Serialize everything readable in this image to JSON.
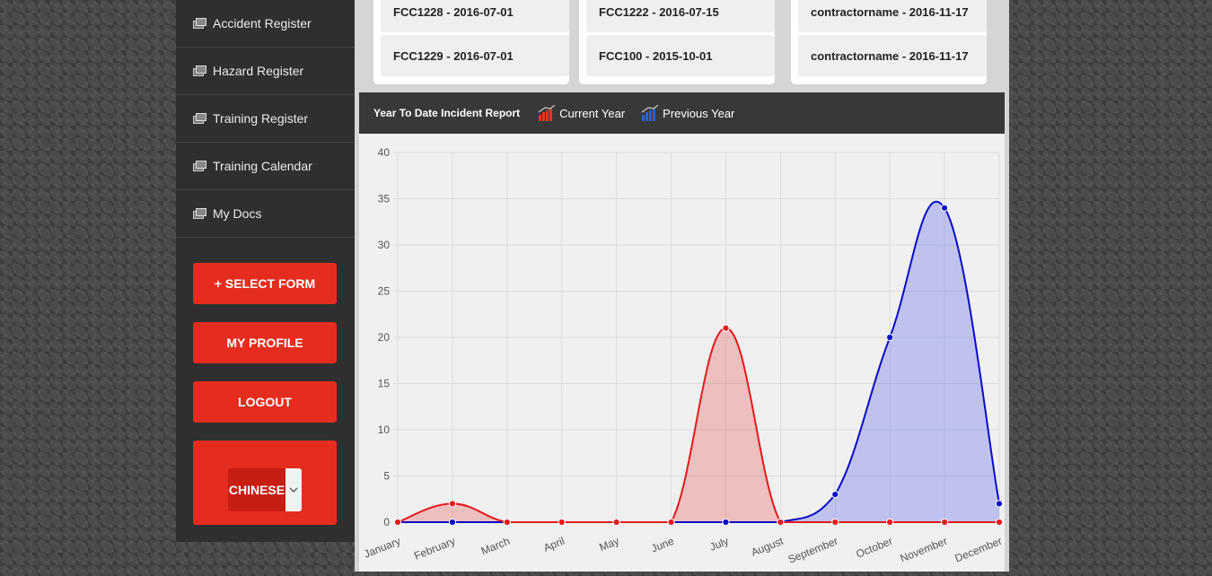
{
  "sidebar": {
    "items": [
      {
        "label": "Accident Register"
      },
      {
        "label": "Hazard Register"
      },
      {
        "label": "Training Register"
      },
      {
        "label": "Training Calendar"
      },
      {
        "label": "My Docs"
      }
    ],
    "select_form": "+ SELECT FORM",
    "my_profile": "MY PROFILE",
    "logout": "LOGOUT",
    "language": "CHINESE"
  },
  "cards": [
    [
      "FCC1228 - 2016-07-01",
      "FCC1229 - 2016-07-01"
    ],
    [
      "FCC1222 - 2016-07-15",
      "FCC100 - 2015-10-01"
    ],
    [
      "contractorname - 2016-11-17",
      "contractorname - 2016-11-17"
    ]
  ],
  "chart_header": {
    "title": "Year To Date Incident Report",
    "current": "Current Year",
    "previous": "Previous Year"
  },
  "chart_data": {
    "type": "area",
    "categories": [
      "January",
      "February",
      "March",
      "April",
      "May",
      "June",
      "July",
      "August",
      "September",
      "October",
      "November",
      "December"
    ],
    "series": [
      {
        "name": "Current Year",
        "color": "#e41a1c",
        "values": [
          0,
          2,
          0,
          0,
          0,
          0,
          21,
          0,
          0,
          0,
          0,
          0
        ]
      },
      {
        "name": "Previous Year",
        "color": "#0a0ac8",
        "values": [
          0,
          0,
          0,
          0,
          0,
          0,
          0,
          0,
          3,
          20,
          34,
          2
        ]
      }
    ],
    "ylim": [
      0,
      40
    ],
    "yticks": [
      0,
      5,
      10,
      15,
      20,
      25,
      30,
      35,
      40
    ],
    "grid": true
  }
}
